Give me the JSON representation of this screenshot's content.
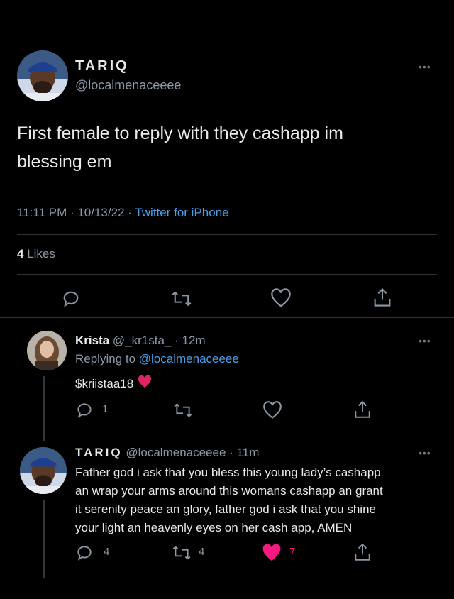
{
  "tweet": {
    "author_name": "TARIQ",
    "author_handle": "@localmenaceeee",
    "text_line1": "First female to reply with they cashapp im",
    "text_line2": "blessing em",
    "time": "11:11 PM · 10/13/22 · ",
    "source": "Twitter for iPhone",
    "likes_count": "4",
    "likes_label": " Likes",
    "more_label": "•••"
  },
  "reply1": {
    "name": "Krista",
    "handle": "@_kr1sta_",
    "time": "· 12m",
    "replying_prefix": "Replying to ",
    "replying_handle": "@localmenaceeee",
    "text": "$kriistaa18",
    "reply_count": "1",
    "more_label": "•••"
  },
  "reply2": {
    "name": "TARIQ",
    "handle": "@localmenaceeee",
    "time": "· 11m",
    "line1": "Father god i ask that you bless this young lady’s cashapp",
    "line2": "an wrap your arms around this womans cashapp an grant",
    "line3": "it serenity peace an glory, father god i ask that you shine",
    "line4": "your light an heavenly eyes on her cash app, AMEN",
    "reply_count": "4",
    "retweet_count": "4",
    "like_count": "7",
    "more_label": "•••"
  },
  "colors": {
    "background": "#000000",
    "text": "#e7e9ea",
    "muted": "#8b98a5",
    "link": "#4a9ee8",
    "heart": "#f91880",
    "emoji_heart": "#e0245e"
  }
}
